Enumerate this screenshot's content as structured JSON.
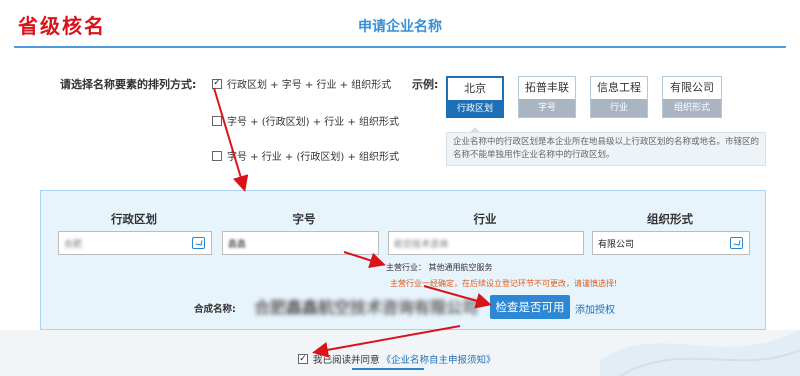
{
  "stamp_text": "省级核名",
  "page_title": "申请企业名称",
  "order": {
    "label": "请选择名称要素的排列方式:",
    "options": [
      {
        "label": "行政区划 + 字号 + 行业 + 组织形式",
        "checked": true
      },
      {
        "label": "字号 + (行政区划) + 行业 + 组织形式",
        "checked": false
      },
      {
        "label": "字号 + 行业 + (行政区划) + 组织形式",
        "checked": false
      }
    ]
  },
  "example": {
    "label": "示例:",
    "cards": [
      {
        "word": "北京",
        "tag": "行政区划",
        "active": true
      },
      {
        "word": "拓普丰联",
        "tag": "字号",
        "active": false
      },
      {
        "word": "信息工程",
        "tag": "行业",
        "active": false
      },
      {
        "word": "有限公司",
        "tag": "组织形式",
        "active": false
      }
    ],
    "tip": "企业名称中的行政区划是本企业所在地县级以上行政区划的名称或地名。市辖区的名称不能单独用作企业名称中的行政区划。"
  },
  "form": {
    "headers": [
      "行政区划",
      "字号",
      "行业",
      "组织形式"
    ],
    "values": {
      "region": "合肥",
      "brand": "鑫鑫",
      "industry": "航空技术咨询",
      "org_form": "有限公司"
    },
    "main_business": "主营行业： 其他通用航空服务",
    "warning": "主营行业一经确定，在后续设立登记环节不可更改，请谨慎选择!",
    "combined_label": "合成名称:",
    "combined_value": "合肥鑫鑫航空技术咨询有限公司",
    "check_button": "检查是否可用",
    "auth_link": "添加授权"
  },
  "agreement": {
    "prefix": "我已阅读并同意",
    "link": "《企业名称自主申报须知》",
    "checked": true
  },
  "colors": {
    "stamp": "#d8141a",
    "title": "#3a8fd6",
    "accent": "#1d6fb8",
    "panel_bg": "#e8f4fc",
    "warning": "#e25c1a",
    "annotation_arrow": "#d8141a"
  }
}
